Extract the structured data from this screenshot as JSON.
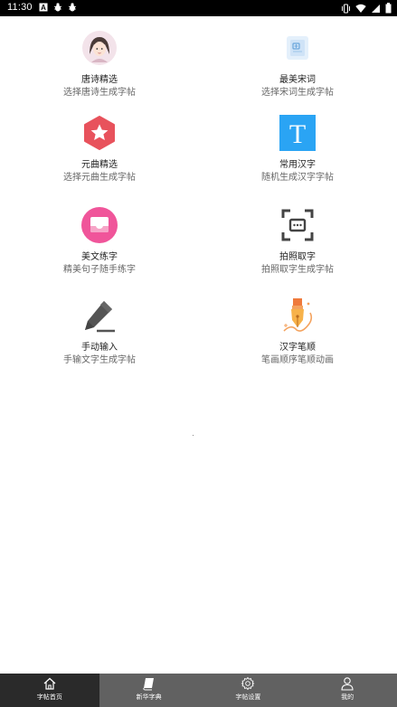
{
  "status_bar": {
    "time": "11:30",
    "left_icons": [
      "a-box-icon",
      "bug-icon",
      "bug-icon"
    ],
    "right_icons": [
      "vibrate-icon",
      "wifi-icon",
      "signal-icon",
      "battery-icon"
    ]
  },
  "items": [
    {
      "title": "唐诗精选",
      "subtitle": "选择唐诗生成字帖",
      "icon": "girl-avatar-icon"
    },
    {
      "title": "最美宋词",
      "subtitle": "选择宋词生成字帖",
      "icon": "document-card-icon"
    },
    {
      "title": "元曲精选",
      "subtitle": "选择元曲生成字帖",
      "icon": "star-hexagon-icon"
    },
    {
      "title": "常用汉字",
      "subtitle": "随机生成汉字字帖",
      "icon": "letter-t-icon"
    },
    {
      "title": "美文练字",
      "subtitle": "精美句子随手练字",
      "icon": "inbox-icon"
    },
    {
      "title": "拍照取字",
      "subtitle": "拍照取字生成字帖",
      "icon": "scan-frame-icon"
    },
    {
      "title": "手动输入",
      "subtitle": "手输文字生成字帖",
      "icon": "pencil-icon"
    },
    {
      "title": "汉字笔顺",
      "subtitle": "笔画顺序笔顺动画",
      "icon": "pen-nib-icon"
    }
  ],
  "bottom_nav": [
    {
      "label": "字帖首页",
      "icon": "home-icon",
      "active": true
    },
    {
      "label": "新华字典",
      "icon": "book-icon",
      "active": false
    },
    {
      "label": "字帖设置",
      "icon": "gear-icon",
      "active": false
    },
    {
      "label": "我的",
      "icon": "person-icon",
      "active": false
    }
  ],
  "colors": {
    "status_bar": "#000000",
    "bottom_nav": "#616161",
    "bottom_nav_active": "#2a2a2a",
    "star_red": "#e8525c",
    "t_blue": "#2aa4f4",
    "inbox_pink": "#f0559a",
    "nib_orange": "#ef7a3c"
  }
}
